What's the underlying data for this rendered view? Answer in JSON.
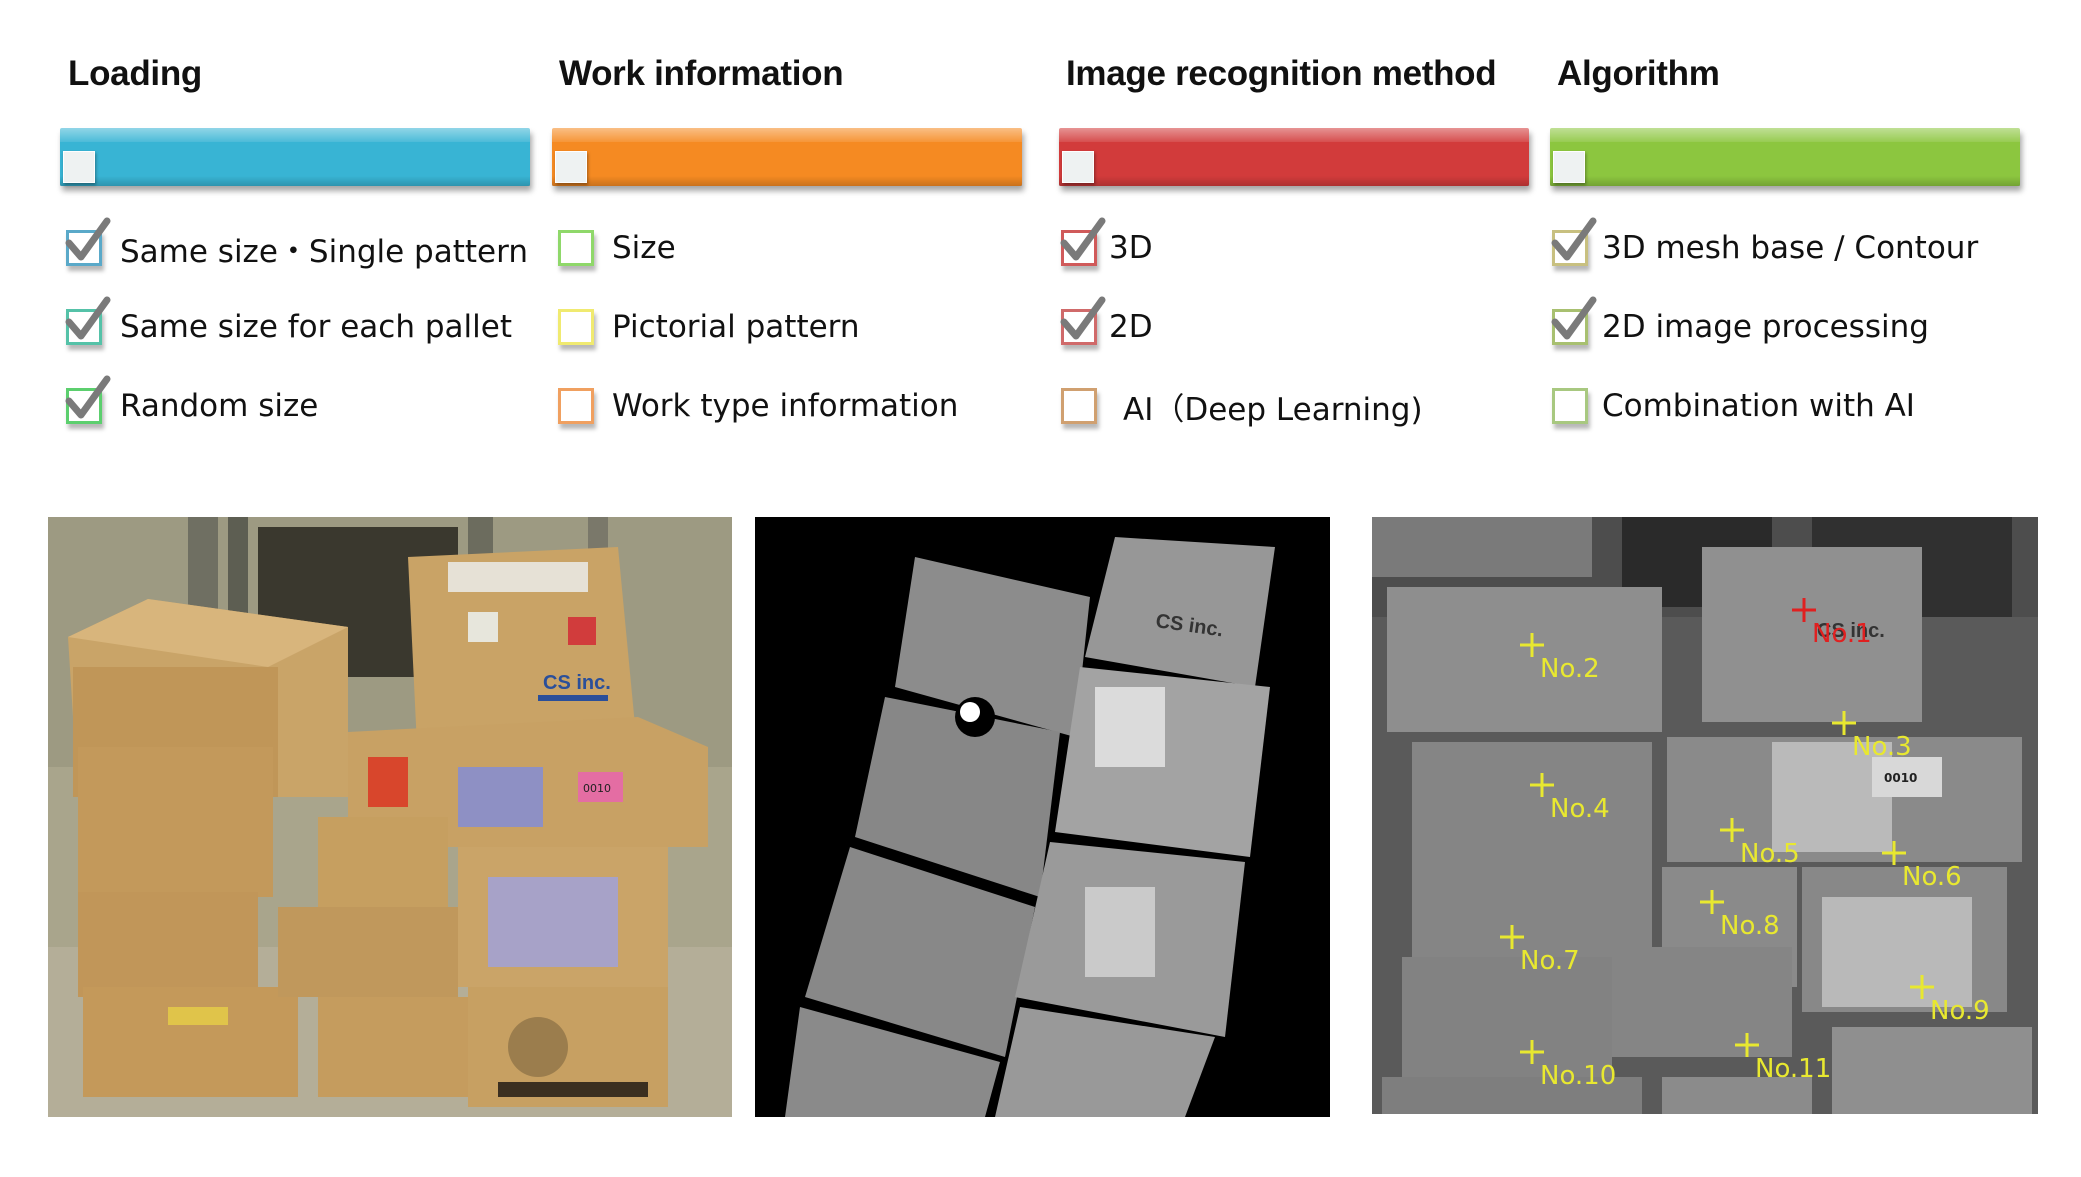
{
  "columns": [
    {
      "title": "Loading",
      "bar_color": "#38b4d4",
      "bar_progress": 0.07,
      "box_colors": [
        "#5aa9c9",
        "#55c2a8",
        "#5ccf6e"
      ],
      "options": [
        {
          "label": "Same size・Single pattern",
          "checked": true
        },
        {
          "label": "Same size for each pallet",
          "checked": true
        },
        {
          "label": "Random size",
          "checked": true
        }
      ]
    },
    {
      "title": "Work information",
      "bar_color": "#f58a22",
      "bar_progress": 0.07,
      "box_colors": [
        "#8fd86a",
        "#f0ea70",
        "#f0a060"
      ],
      "options": [
        {
          "label": "Size",
          "checked": false
        },
        {
          "label": "Pictorial pattern",
          "checked": false
        },
        {
          "label": "Work type information",
          "checked": false
        }
      ]
    },
    {
      "title": "Image recognition method",
      "bar_color": "#d23b3b",
      "bar_progress": 0.07,
      "box_colors": [
        "#d05a5a",
        "#d06a6a",
        "#d0a070"
      ],
      "options": [
        {
          "label": "3D",
          "checked": true
        },
        {
          "label": "2D",
          "checked": true
        },
        {
          "label": "AI（Deep Learning)",
          "checked": false
        }
      ]
    },
    {
      "title": "Algorithm",
      "bar_color": "#8cc63f",
      "bar_progress": 0.07,
      "box_colors": [
        "#c8c080",
        "#a8c070",
        "#a8c880"
      ],
      "options": [
        {
          "label": "3D mesh base / Contour",
          "checked": true
        },
        {
          "label": "2D image processing",
          "checked": true
        },
        {
          "label": "Combination with AI",
          "checked": false
        }
      ]
    }
  ],
  "photos": {
    "color_photo": {
      "alt": "Stack of cardboard boxes (color photo)",
      "box_text": "CS inc.",
      "sticker": "0010"
    },
    "depth_image": {
      "alt": "3D depth image of boxes",
      "box_text": "CS inc."
    },
    "recognition_image": {
      "alt": "2D recognition result with numbered boxes",
      "labels": [
        {
          "text": "No.1",
          "color": "#e02020"
        },
        {
          "text": "No.2",
          "color": "#e8e830"
        },
        {
          "text": "No.3",
          "color": "#e8e830"
        },
        {
          "text": "No.4",
          "color": "#e8e830"
        },
        {
          "text": "No.5",
          "color": "#e8e830"
        },
        {
          "text": "No.6",
          "color": "#e8e830"
        },
        {
          "text": "No.7",
          "color": "#e8e830"
        },
        {
          "text": "No.8",
          "color": "#e8e830"
        },
        {
          "text": "No.9",
          "color": "#e8e830"
        },
        {
          "text": "No.10",
          "color": "#e8e830"
        },
        {
          "text": "No.11",
          "color": "#e8e830"
        }
      ],
      "box_text": "CS inc.",
      "sticker": "0010"
    }
  }
}
